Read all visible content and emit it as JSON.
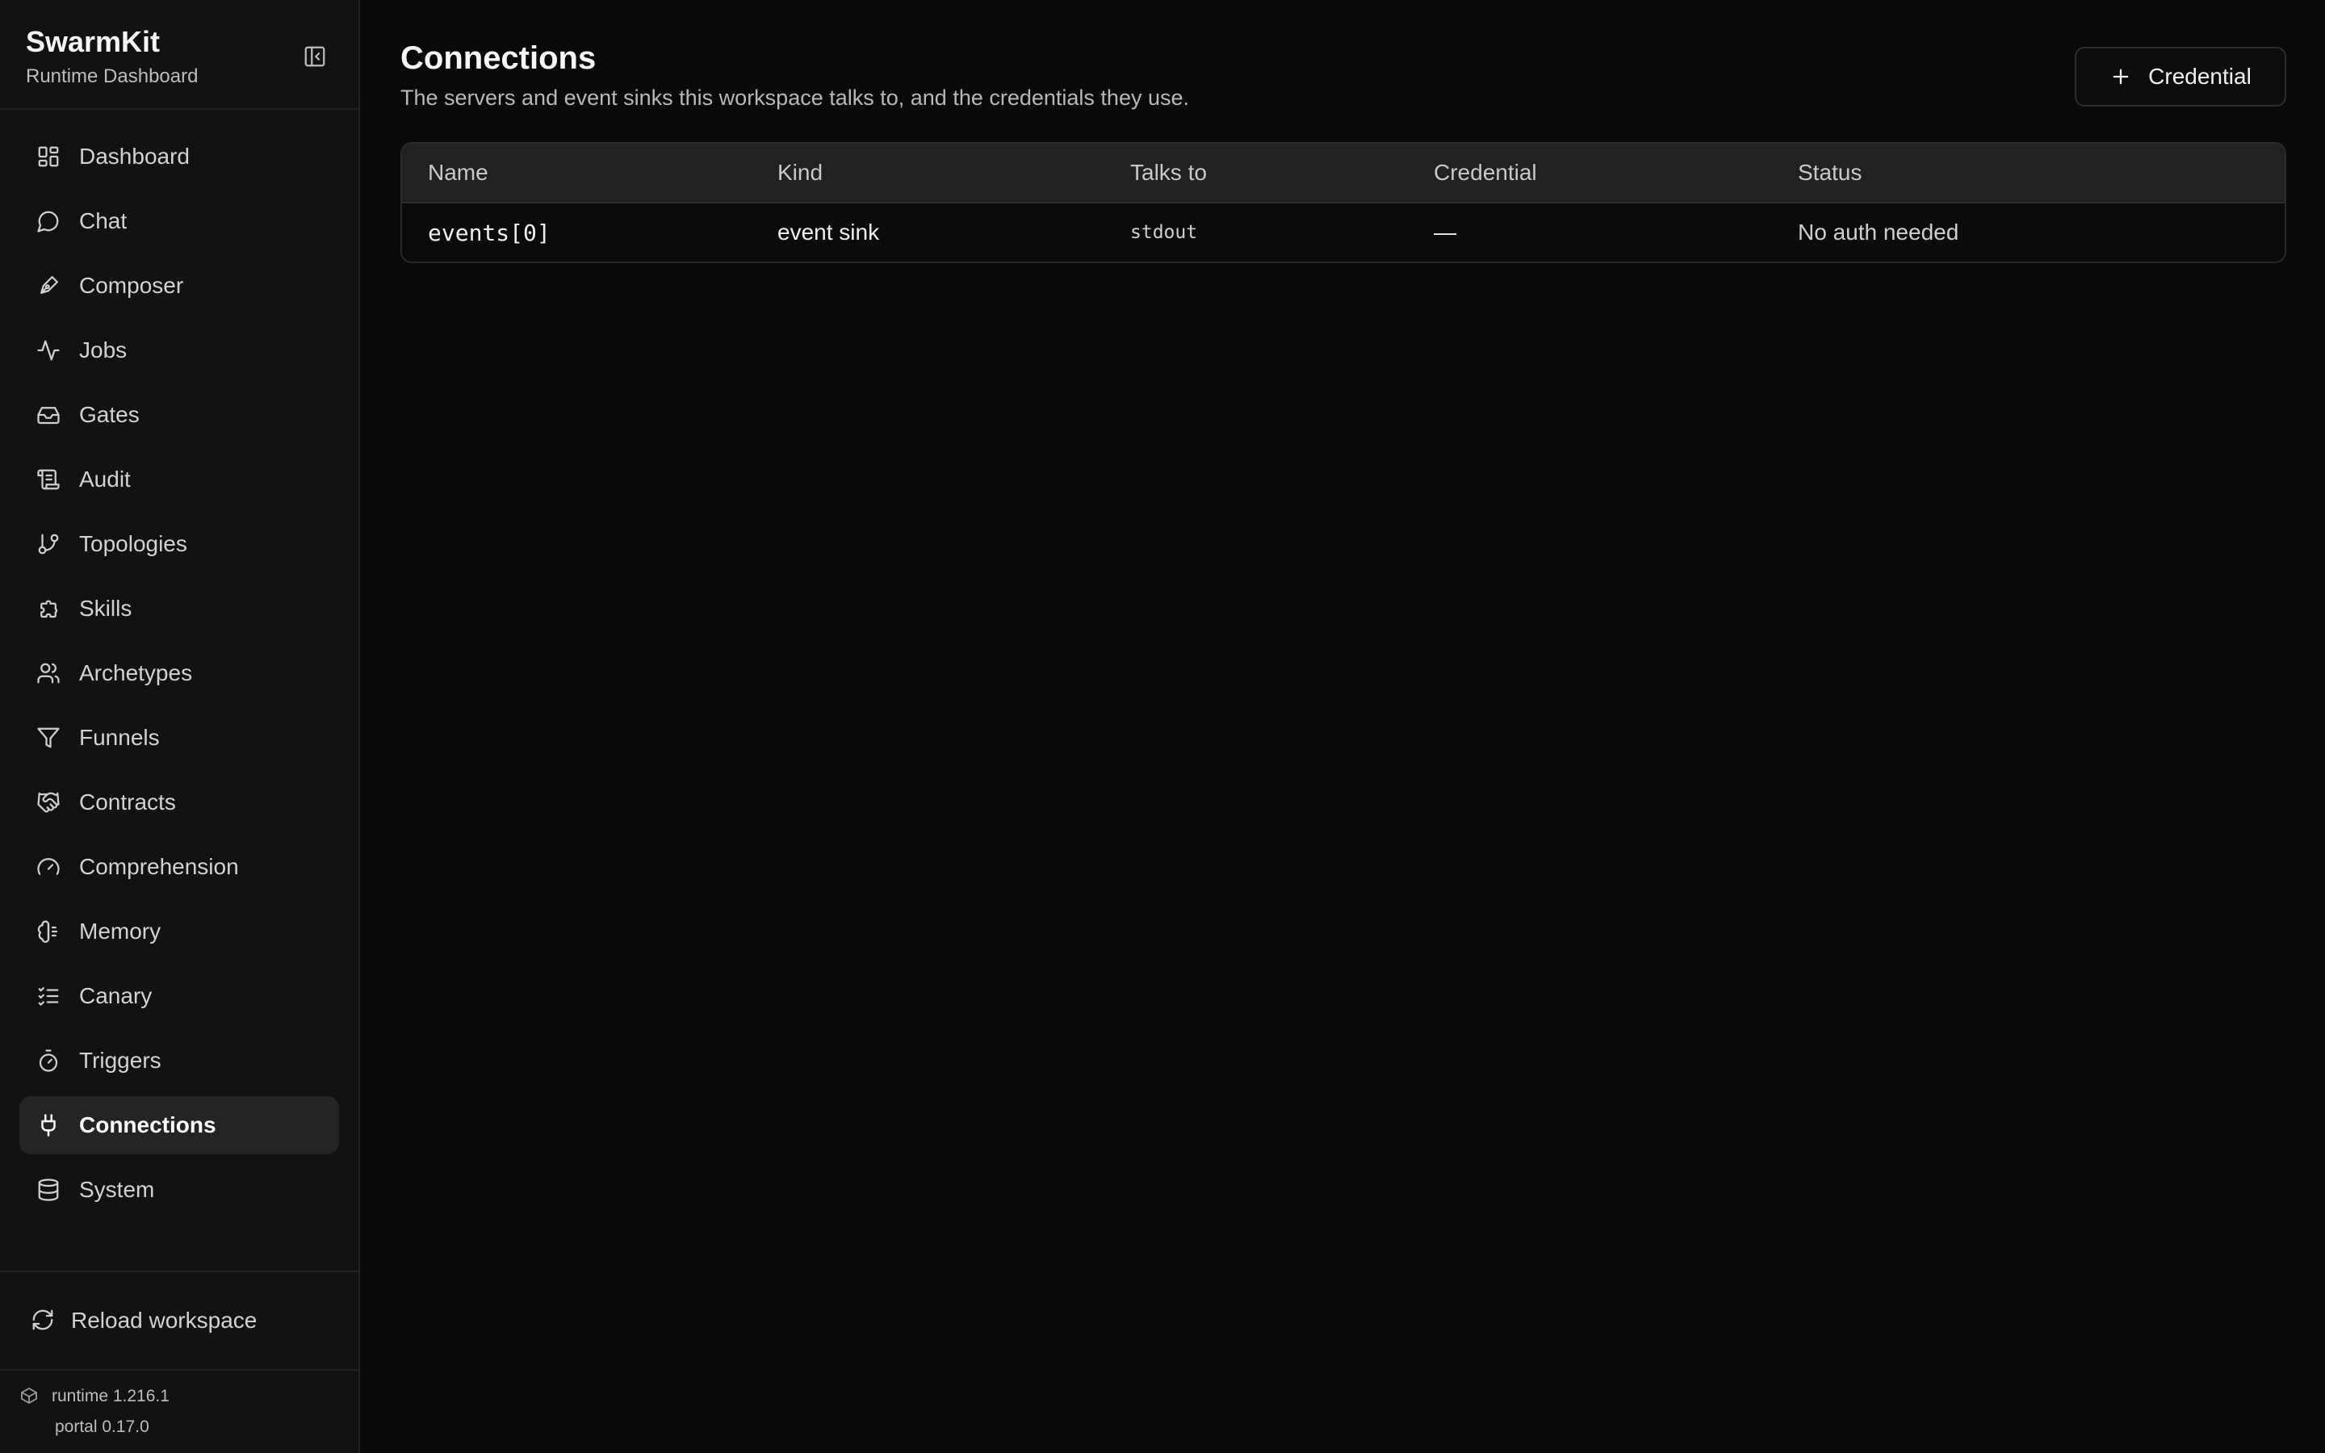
{
  "sidebar": {
    "brand_title": "SwarmKit",
    "brand_subtitle": "Runtime Dashboard",
    "items": [
      {
        "label": "Dashboard",
        "icon": "dashboard-icon"
      },
      {
        "label": "Chat",
        "icon": "chat-icon"
      },
      {
        "label": "Composer",
        "icon": "pen-icon"
      },
      {
        "label": "Jobs",
        "icon": "activity-icon"
      },
      {
        "label": "Gates",
        "icon": "inbox-icon"
      },
      {
        "label": "Audit",
        "icon": "scroll-icon"
      },
      {
        "label": "Topologies",
        "icon": "git-branch-icon"
      },
      {
        "label": "Skills",
        "icon": "puzzle-icon"
      },
      {
        "label": "Archetypes",
        "icon": "users-icon"
      },
      {
        "label": "Funnels",
        "icon": "filter-icon"
      },
      {
        "label": "Contracts",
        "icon": "handshake-icon"
      },
      {
        "label": "Comprehension",
        "icon": "gauge-icon"
      },
      {
        "label": "Memory",
        "icon": "brain-icon"
      },
      {
        "label": "Canary",
        "icon": "checklist-icon"
      },
      {
        "label": "Triggers",
        "icon": "timer-icon"
      },
      {
        "label": "Connections",
        "icon": "plug-icon",
        "active": true
      },
      {
        "label": "System",
        "icon": "database-icon"
      }
    ],
    "reload_label": "Reload workspace",
    "runtime_version": "runtime 1.216.1",
    "portal_version": "portal 0.17.0"
  },
  "main": {
    "title": "Connections",
    "subtitle": "The servers and event sinks this workspace talks to, and the credentials they use.",
    "credential_button": "Credential",
    "table": {
      "headers": [
        "Name",
        "Kind",
        "Talks to",
        "Credential",
        "Status"
      ],
      "rows": [
        {
          "name": "events[0]",
          "kind": "event sink",
          "talks_to": "stdout",
          "credential": "—",
          "status": "No auth needed"
        }
      ]
    }
  },
  "colors": {
    "background": "#0a0a0a",
    "sidebar": "#121212",
    "active_item": "#242424",
    "table_header": "#212121"
  }
}
